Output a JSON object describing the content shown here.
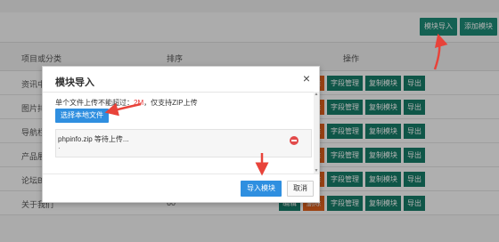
{
  "toolbar": {
    "import_label": "模块导入",
    "add_label": "添加模块"
  },
  "table": {
    "headers": {
      "name": "项目或分类",
      "sort": "排序",
      "ops": "操作"
    },
    "rows": [
      {
        "name": "资讯中",
        "sort": ""
      },
      {
        "name": "图片排",
        "sort": ""
      },
      {
        "name": "导航栏",
        "sort": ""
      },
      {
        "name": "产品展",
        "sort": ""
      },
      {
        "name": "论坛B",
        "sort": ""
      },
      {
        "name": "关于我们",
        "sort": "60"
      }
    ],
    "op_labels": {
      "edit": "编辑",
      "delete": "删除",
      "fields": "字段管理",
      "copy": "复制模块",
      "export": "导出"
    }
  },
  "modal": {
    "title": "模块导入",
    "close_symbol": "×",
    "limit_prefix": "单个文件上传不能超过：",
    "limit_value": "2M",
    "limit_suffix": "，仅支持ZIP上传",
    "choose_label": "选择本地文件",
    "file_name": "phpinfo.zip 等待上传...",
    "file_dot": "·",
    "confirm_label": "导入模块",
    "cancel_label": "取消"
  },
  "colors": {
    "accent_green": "#1e8c78",
    "primary_blue": "#2f8fe0",
    "danger_red": "#e62e2e",
    "arrow_red": "#e8433a"
  }
}
